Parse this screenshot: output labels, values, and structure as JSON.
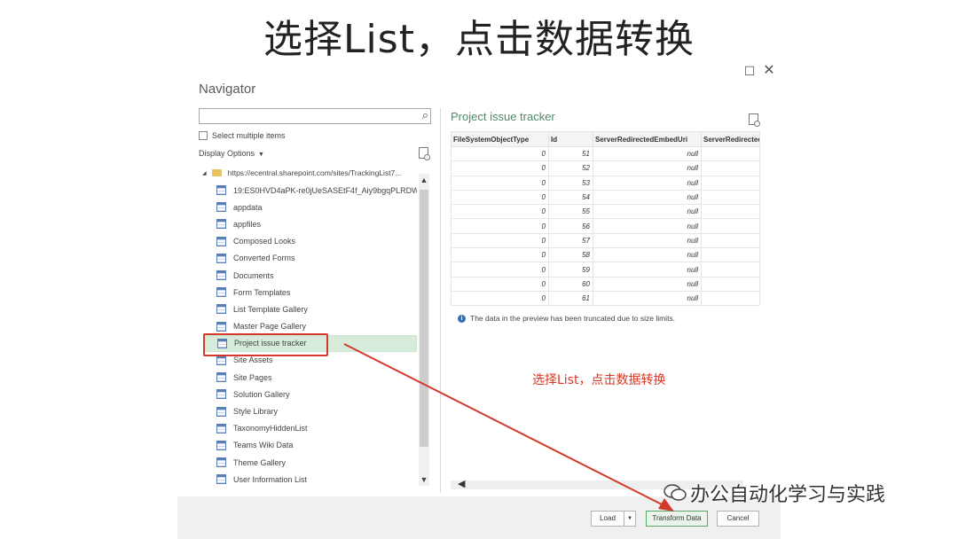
{
  "slide": {
    "title": "选择List，点击数据转换",
    "annotation": "选择List，点击数据转换",
    "watermark": "办公自动化学习与实践",
    "accent_red": "#d33a2c"
  },
  "window": {
    "maximize": "☐",
    "close": "✕"
  },
  "navigator": {
    "title": "Navigator",
    "search_value": "",
    "select_multiple": "Select multiple items",
    "display_options": "Display Options",
    "root": "https://ecentral.sharepoint.com/sites/TrackingList7...",
    "items": [
      {
        "label": "19:ES0HVD4aPK-re0jUeSASEtF4f_Aiy9bgqPLRDW...",
        "selected": false
      },
      {
        "label": "appdata",
        "selected": false
      },
      {
        "label": "appfiles",
        "selected": false
      },
      {
        "label": "Composed Looks",
        "selected": false
      },
      {
        "label": "Converted Forms",
        "selected": false
      },
      {
        "label": "Documents",
        "selected": false
      },
      {
        "label": "Form Templates",
        "selected": false
      },
      {
        "label": "List Template Gallery",
        "selected": false
      },
      {
        "label": "Master Page Gallery",
        "selected": false
      },
      {
        "label": "Project issue tracker",
        "selected": true
      },
      {
        "label": "Site Assets",
        "selected": false
      },
      {
        "label": "Site Pages",
        "selected": false
      },
      {
        "label": "Solution Gallery",
        "selected": false
      },
      {
        "label": "Style Library",
        "selected": false
      },
      {
        "label": "TaxonomyHiddenList",
        "selected": false
      },
      {
        "label": "Teams Wiki Data",
        "selected": false
      },
      {
        "label": "Theme Gallery",
        "selected": false
      },
      {
        "label": "User Information List",
        "selected": false
      }
    ]
  },
  "preview": {
    "title": "Project issue tracker",
    "columns": [
      "FileSystemObjectType",
      "Id",
      "ServerRedirectedEmbedUri",
      "ServerRedirectec"
    ],
    "rows": [
      [
        "0",
        "51",
        "null",
        ""
      ],
      [
        "0",
        "52",
        "null",
        ""
      ],
      [
        "0",
        "53",
        "null",
        ""
      ],
      [
        "0",
        "54",
        "null",
        ""
      ],
      [
        "0",
        "55",
        "null",
        ""
      ],
      [
        "0",
        "56",
        "null",
        ""
      ],
      [
        "0",
        "57",
        "null",
        ""
      ],
      [
        "0",
        "58",
        "null",
        ""
      ],
      [
        "0",
        "59",
        "null",
        ""
      ],
      [
        "0",
        "60",
        "null",
        ""
      ],
      [
        "0",
        "61",
        "null",
        ""
      ]
    ],
    "truncated_note": "The data in the preview has been truncated due to size limits."
  },
  "footer": {
    "load": "Load",
    "transform": "Transform Data",
    "cancel": "Cancel"
  }
}
